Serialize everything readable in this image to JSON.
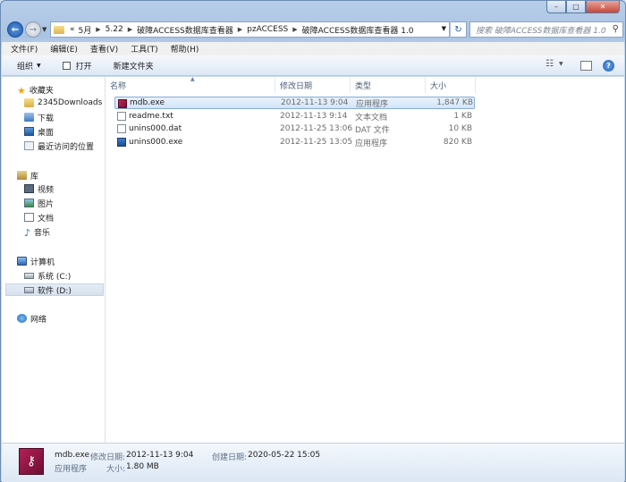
{
  "window": {
    "caption": {
      "min": "–",
      "max": "□",
      "close": "✕"
    }
  },
  "address_bar": {
    "overflow": "«",
    "crumbs": [
      "5月",
      "5.22",
      "破障ACCESS数据库查看器",
      "pzACCESS",
      "破障ACCESS数据库查看器 1.0"
    ],
    "search_placeholder": "搜索 破障ACCESS数据库查看器 1.0"
  },
  "menu": [
    "文件(F)",
    "编辑(E)",
    "查看(V)",
    "工具(T)",
    "帮助(H)"
  ],
  "toolbar": {
    "organize": "组织",
    "open": "打开",
    "new_folder": "新建文件夹"
  },
  "nav": {
    "favorites": "收藏夹",
    "fav_items": [
      "2345Downloads",
      "下载",
      "桌面",
      "最近访问的位置"
    ],
    "libraries": "库",
    "lib_items": [
      "视频",
      "图片",
      "文档",
      "音乐"
    ],
    "computer": "计算机",
    "drives": [
      "系统 (C:)",
      "软件 (D:)"
    ],
    "network": "网络"
  },
  "columns": {
    "name": "名称",
    "date": "修改日期",
    "type": "类型",
    "size": "大小"
  },
  "files": [
    {
      "name": "mdb.exe",
      "date": "2012-11-13 9:04",
      "type": "应用程序",
      "size": "1,847 KB",
      "icon": "mdb-app-icon"
    },
    {
      "name": "readme.txt",
      "date": "2012-11-13 9:14",
      "type": "文本文档",
      "size": "1 KB",
      "icon": "text-file-icon"
    },
    {
      "name": "unins000.dat",
      "date": "2012-11-25 13:06",
      "type": "DAT 文件",
      "size": "10 KB",
      "icon": "dat-file-icon"
    },
    {
      "name": "unins000.exe",
      "date": "2012-11-25 13:05",
      "type": "应用程序",
      "size": "820 KB",
      "icon": "uninstaller-icon"
    }
  ],
  "details": {
    "name": "mdb.exe",
    "modified_label": "修改日期:",
    "modified": "2012-11-13 9:04",
    "created_label": "创建日期:",
    "created": "2020-05-22 15:05",
    "type": "应用程序",
    "size_label": "大小:",
    "size": "1.80 MB"
  }
}
